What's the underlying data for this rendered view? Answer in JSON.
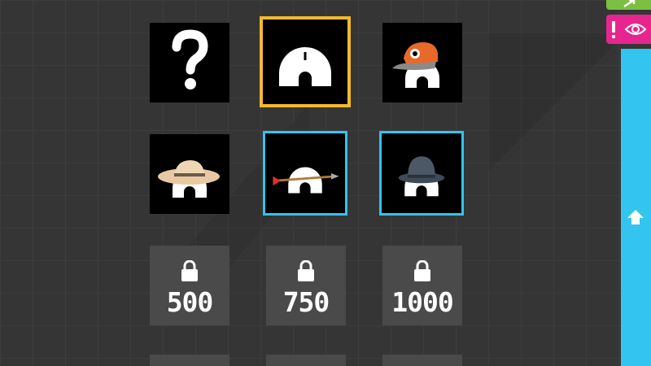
{
  "characters": [
    {
      "id": "random",
      "icon": "question-mark-icon",
      "state": "owned"
    },
    {
      "id": "plain",
      "icon": "protractor-icon",
      "state": "selected"
    },
    {
      "id": "cap",
      "icon": "protractor-orange-cap-icon",
      "state": "owned"
    },
    {
      "id": "sunhat",
      "icon": "protractor-sun-hat-icon",
      "state": "owned"
    },
    {
      "id": "arrow",
      "icon": "protractor-arrow-icon",
      "state": "highlighted"
    },
    {
      "id": "bowler",
      "icon": "protractor-bowler-hat-icon",
      "state": "highlighted"
    }
  ],
  "locked_items": [
    {
      "price": "500",
      "icon": "lock-icon"
    },
    {
      "price": "750",
      "icon": "lock-icon"
    },
    {
      "price": "1000",
      "icon": "lock-icon"
    }
  ],
  "side_buttons": {
    "top": {
      "icon": "arrow-icon",
      "color": "#7cbf43"
    },
    "view": {
      "icons": [
        "exclamation-icon",
        "eye-icon"
      ],
      "color": "#e6258f"
    },
    "panel": {
      "icon": "home-arrow-icon",
      "color": "#33c4ef"
    }
  },
  "colors": {
    "selected_border": "#f5b82e",
    "highlight_border": "#33c3f0",
    "background": "#353535"
  }
}
